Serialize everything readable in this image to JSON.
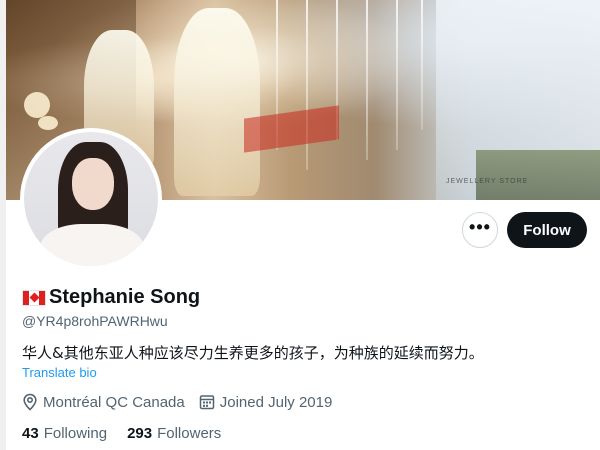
{
  "profile": {
    "name": "Stephanie Song",
    "handle": "@YR4p8rohPAWRHwu",
    "flag": "canada-flag",
    "bio": "华人&其他东亚人种应该尽力生养更多的孩子，为种族的延续而努力。",
    "translate_label": "Translate bio",
    "location": "Montréal QC Canada",
    "joined": "Joined July 2019"
  },
  "stats": {
    "following_count": "43",
    "following_label": "Following",
    "followers_count": "293",
    "followers_label": "Followers"
  },
  "actions": {
    "more_label": "•••",
    "follow_label": "Follow"
  },
  "banner": {
    "store_text": "JEWELLERY STORE"
  },
  "colors": {
    "accent": "#1d9bf0",
    "button_dark": "#0f1419",
    "muted_text": "#536471"
  }
}
